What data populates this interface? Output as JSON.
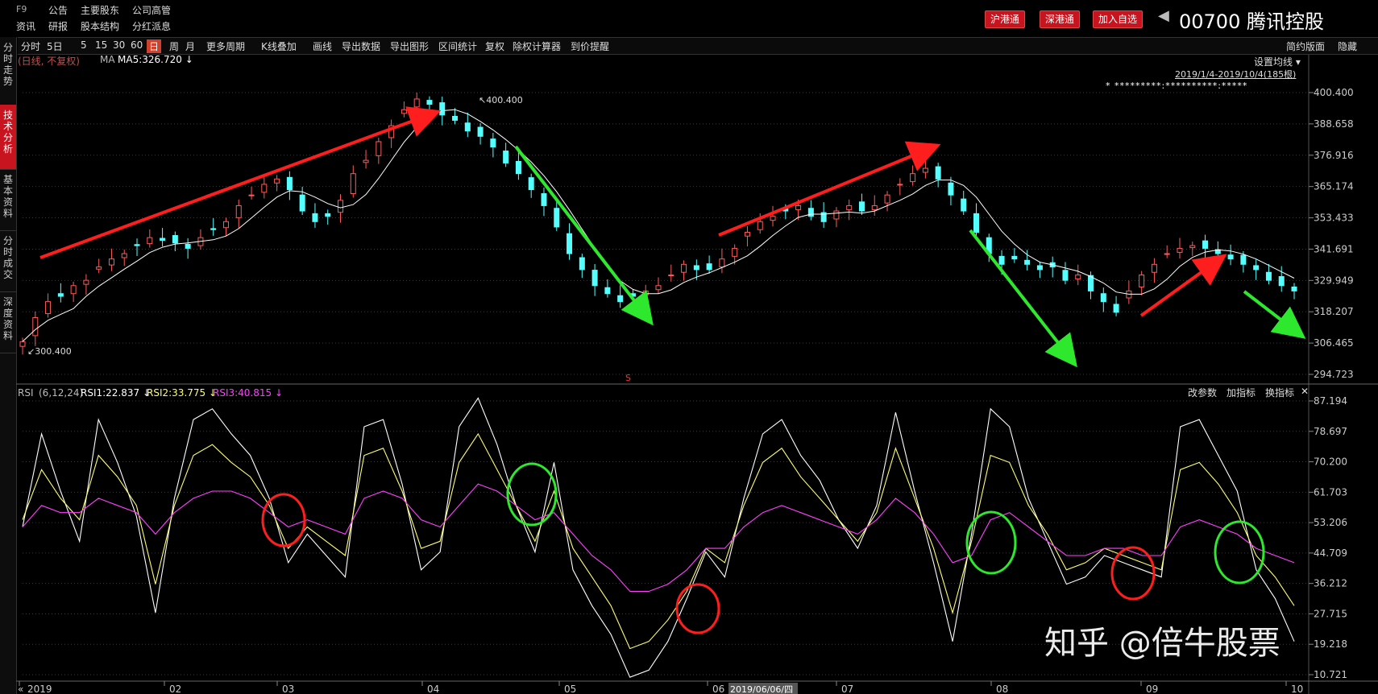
{
  "header": {
    "logo": "F9",
    "menu_row1": [
      "公告",
      "主要股东",
      "公司高管"
    ],
    "menu_row2_first": "资讯",
    "menu_row2": [
      "研报",
      "股本结构",
      "分红派息"
    ],
    "buttons": [
      "沪港通",
      "深港通",
      "加入自选"
    ],
    "nav_icon": "triangle-left-icon",
    "stock_code": "00700",
    "stock_name": "腾讯控股"
  },
  "toolbar": {
    "items": [
      "分时",
      "5日",
      "5",
      "15",
      "30",
      "60",
      "日",
      "周",
      "月",
      "更多周期",
      "K线叠加",
      "画线",
      "导出数据",
      "导出图形",
      "区间统计",
      "复权",
      "除权计算器",
      "到价提醒"
    ],
    "active": "日",
    "right_items": [
      "简约版面",
      "隐藏"
    ]
  },
  "left_tabs": [
    {
      "label": "分时走势",
      "active": false
    },
    {
      "label": "技术分析",
      "active": true
    },
    {
      "label": "基本资料",
      "active": false
    },
    {
      "label": "分时成交",
      "active": false
    },
    {
      "label": "深度资料",
      "active": false
    }
  ],
  "price_panel": {
    "mode_label": "(日线, 不复权)",
    "ma_label": "MA",
    "ma_value": "MA5:326.720",
    "ma_arrow": "↓",
    "settings_label": "设置均线",
    "range_label": "2019/1/4-2019/10/4(185根)",
    "stars": "* *********:**********:*****",
    "high_label": "400.400",
    "low_label": "300.400",
    "s_marker": "S"
  },
  "rsi_panel": {
    "name": "RSI",
    "params": "(6,12,24)",
    "rsi1": "RSI1:22.837",
    "rsi1_arrow": "↓",
    "rsi2": "RSI2:33.775",
    "rsi2_arrow": "↓",
    "rsi3": "RSI3:40.815",
    "rsi3_arrow": "↓",
    "buttons": [
      "改参数",
      "加指标",
      "换指标"
    ],
    "close_icon": "close-icon"
  },
  "x_axis": {
    "labels": [
      "2019",
      "02",
      "03",
      "04",
      "05",
      "06",
      "07",
      "08",
      "09",
      "10"
    ],
    "prefix": "«",
    "highlight_date": "2019/06/06/四"
  },
  "watermark": "知乎 @倍牛股票",
  "colors": {
    "up": "#ff5a5a",
    "down": "#54ffff",
    "ma": "#ffffff",
    "rsi1": "#ffffff",
    "rsi2": "#ffff70",
    "rsi3": "#ff40ff",
    "accent": "#c8141e",
    "grid": "#3a3a3a"
  },
  "chart_data": [
    {
      "type": "candlestick",
      "title": "00700 腾讯控股 日线",
      "x": [
        "2019-01",
        "2019-02",
        "2019-03",
        "2019-04",
        "2019-05",
        "2019-06",
        "2019-07",
        "2019-08",
        "2019-09",
        "2019-10"
      ],
      "y_ticks": [
        400.4,
        388.658,
        376.916,
        365.174,
        353.433,
        341.691,
        329.949,
        318.207,
        306.465,
        294.723
      ],
      "ylim": [
        294.723,
        400.4
      ],
      "close_approx": [
        307,
        316,
        322,
        324,
        328,
        330,
        335,
        338,
        340,
        343,
        346,
        345,
        344,
        342,
        346,
        349,
        352,
        358,
        362,
        366,
        368,
        364,
        356,
        352,
        354,
        360,
        370,
        375,
        382,
        388,
        394,
        398,
        396,
        392,
        390,
        386,
        384,
        380,
        374,
        370,
        364,
        358,
        350,
        340,
        334,
        328,
        325,
        322,
        324,
        326,
        328,
        332,
        336,
        334,
        334,
        338,
        342,
        348,
        352,
        354,
        356,
        358,
        354,
        352,
        356,
        358,
        356,
        358,
        362,
        366,
        370,
        372,
        368,
        362,
        356,
        348,
        340,
        336,
        338,
        336,
        334,
        335,
        330,
        332,
        326,
        322,
        318,
        326,
        332,
        336,
        340,
        342,
        343,
        342,
        340,
        338,
        336,
        334,
        330,
        328,
        326
      ],
      "ma_label": "MA5:326.720",
      "high": 400.4,
      "low": 300.4,
      "annotations": [
        {
          "type": "arrow",
          "color": "red",
          "from": "2019-01",
          "to": "2019-04",
          "direction": "up"
        },
        {
          "type": "arrow",
          "color": "green",
          "from": "2019-04",
          "to": "2019-05",
          "direction": "down"
        },
        {
          "type": "arrow",
          "color": "red",
          "from": "2019-06",
          "to": "2019-07",
          "direction": "up"
        },
        {
          "type": "arrow",
          "color": "green",
          "from": "2019-08",
          "to": "2019-08",
          "direction": "down"
        },
        {
          "type": "arrow",
          "color": "red",
          "from": "2019-09",
          "to": "2019-09",
          "direction": "up"
        },
        {
          "type": "arrow",
          "color": "green",
          "from": "2019-10",
          "to": "2019-10",
          "direction": "down"
        }
      ]
    },
    {
      "type": "line",
      "title": "RSI (6,12,24)",
      "y_ticks": [
        87.194,
        78.697,
        70.2,
        61.703,
        53.206,
        44.709,
        36.212,
        27.715,
        19.218,
        10.721
      ],
      "ylim": [
        10.721,
        87.194
      ],
      "series": [
        {
          "name": "RSI1",
          "color": "#ffffff",
          "values": [
            52,
            78,
            62,
            48,
            82,
            70,
            55,
            28,
            60,
            82,
            85,
            78,
            72,
            60,
            42,
            50,
            44,
            38,
            80,
            82,
            64,
            40,
            45,
            80,
            88,
            75,
            58,
            45,
            70,
            40,
            30,
            22,
            10,
            12,
            20,
            32,
            45,
            38,
            60,
            78,
            82,
            72,
            65,
            54,
            46,
            58,
            84,
            62,
            42,
            20,
            50,
            85,
            80,
            60,
            48,
            36,
            38,
            44,
            42,
            40,
            38,
            80,
            82,
            72,
            62,
            40,
            32,
            20
          ]
        },
        {
          "name": "RSI2",
          "color": "#ffff70",
          "values": [
            54,
            68,
            60,
            54,
            72,
            66,
            58,
            36,
            58,
            72,
            75,
            70,
            66,
            58,
            46,
            52,
            48,
            44,
            72,
            74,
            62,
            46,
            48,
            70,
            78,
            68,
            58,
            48,
            62,
            46,
            38,
            30,
            18,
            20,
            26,
            34,
            46,
            42,
            58,
            70,
            74,
            66,
            60,
            54,
            48,
            56,
            74,
            60,
            46,
            28,
            48,
            72,
            70,
            58,
            50,
            40,
            42,
            46,
            44,
            42,
            40,
            68,
            70,
            64,
            56,
            44,
            38,
            30
          ]
        },
        {
          "name": "RSI3",
          "color": "#ff40ff",
          "values": [
            52,
            58,
            56,
            56,
            60,
            58,
            56,
            50,
            56,
            60,
            62,
            62,
            60,
            56,
            52,
            54,
            52,
            50,
            60,
            62,
            60,
            54,
            52,
            58,
            64,
            62,
            58,
            54,
            56,
            50,
            44,
            40,
            34,
            34,
            36,
            40,
            46,
            46,
            52,
            56,
            58,
            56,
            54,
            52,
            50,
            54,
            60,
            56,
            50,
            42,
            44,
            54,
            56,
            52,
            48,
            44,
            44,
            46,
            46,
            44,
            44,
            52,
            54,
            52,
            50,
            46,
            44,
            42
          ]
        }
      ],
      "annotations": [
        {
          "type": "circle",
          "color": "red"
        },
        {
          "type": "circle",
          "color": "green"
        },
        {
          "type": "circle",
          "color": "red"
        },
        {
          "type": "circle",
          "color": "green"
        },
        {
          "type": "circle",
          "color": "red"
        },
        {
          "type": "circle",
          "color": "green"
        }
      ]
    }
  ]
}
